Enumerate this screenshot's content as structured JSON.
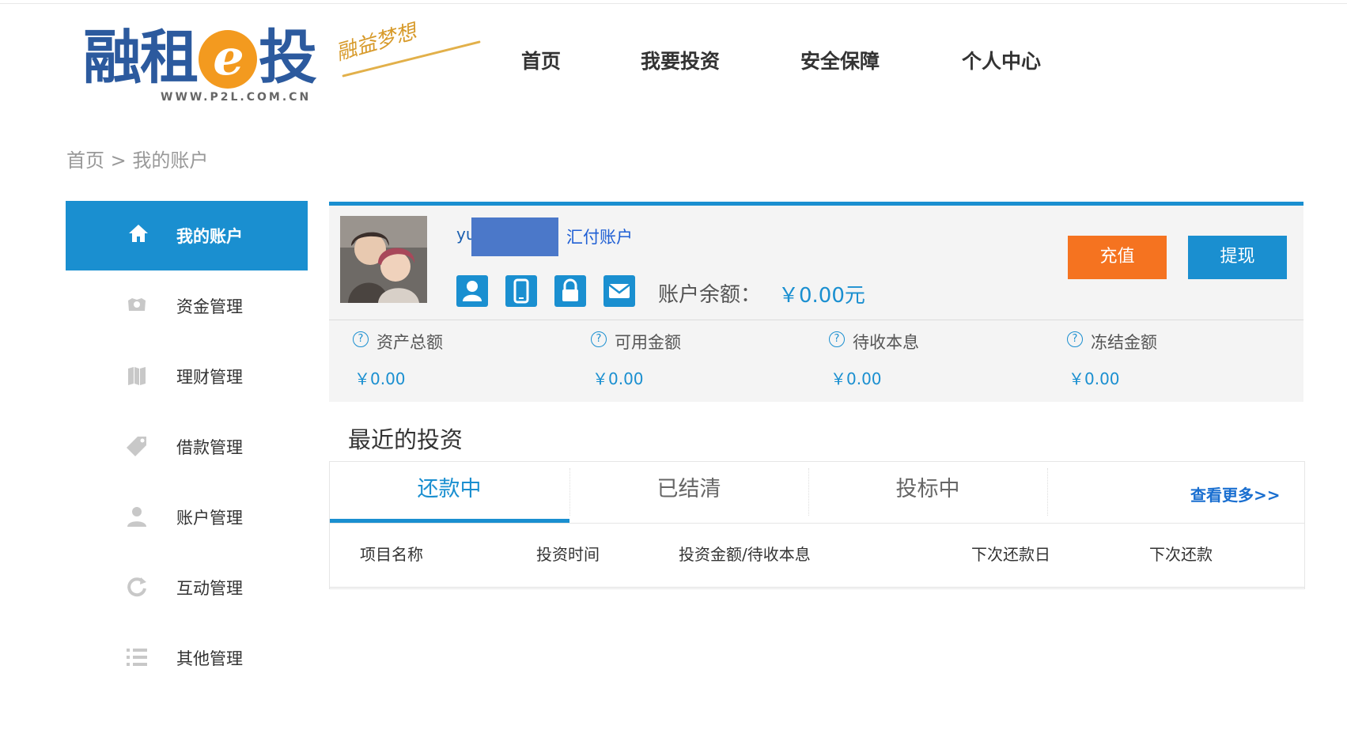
{
  "brand": {
    "name_left": "融租",
    "name_e": "e",
    "name_right": "投",
    "url": "WWW.P2L.COM.CN",
    "slogan": "融益梦想"
  },
  "nav": {
    "items": [
      "首页",
      "我要投资",
      "安全保障",
      "个人中心"
    ]
  },
  "breadcrumb": {
    "home": "首页",
    "separator": " > ",
    "current": "我的账户"
  },
  "sidebar": {
    "items": [
      {
        "label": "我的账户",
        "icon": "home-icon",
        "active": true
      },
      {
        "label": "资金管理",
        "icon": "money-icon"
      },
      {
        "label": "理财管理",
        "icon": "map-icon"
      },
      {
        "label": "借款管理",
        "icon": "tag-icon"
      },
      {
        "label": "账户管理",
        "icon": "user-icon"
      },
      {
        "label": "互动管理",
        "icon": "refresh-icon"
      },
      {
        "label": "其他管理",
        "icon": "list-icon"
      }
    ]
  },
  "account": {
    "username_prefix": "yu",
    "fund_account_label": "汇付账户",
    "verify_icons": [
      "user-verify-icon",
      "phone-verify-icon",
      "lock-verify-icon",
      "email-verify-icon"
    ],
    "balance_label": "账户余额：",
    "balance_value": "￥0.00元",
    "recharge_label": "充值",
    "withdraw_label": "提现",
    "stats": [
      {
        "label": "资产总额",
        "value": "￥0.00"
      },
      {
        "label": "可用金额",
        "value": "￥0.00"
      },
      {
        "label": "待收本息",
        "value": "￥0.00"
      },
      {
        "label": "冻结金额",
        "value": "￥0.00"
      }
    ]
  },
  "recent": {
    "title": "最近的投资",
    "tabs": [
      "还款中",
      "已结清",
      "投标中"
    ],
    "active_tab": 0,
    "more_label": "查看更多>>",
    "columns": [
      "项目名称",
      "投资时间",
      "投资金额/待收本息",
      "下次还款日",
      "下次还款"
    ]
  },
  "colors": {
    "primary": "#1a8fd0",
    "orange": "#f57320",
    "logo_blue": "#2c5a9e"
  }
}
